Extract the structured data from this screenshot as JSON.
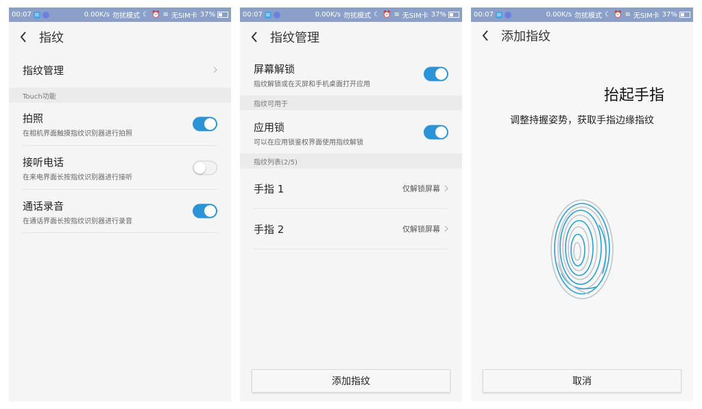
{
  "status": {
    "time": "00:07",
    "speed": "0.00K/s",
    "dnd": "勿扰模式",
    "sim": "无SIM卡",
    "battery": "37%",
    "battery_level": 0.37,
    "color": "#8aa0c8"
  },
  "accent": "#2b93d6",
  "screen1": {
    "title": "指纹",
    "manage_label": "指纹管理",
    "section_label": "Touch功能",
    "items": [
      {
        "title": "拍照",
        "sub": "在相机界面触摸指纹识别器进行拍照",
        "on": true
      },
      {
        "title": "接听电话",
        "sub": "在来电界面长按指纹识别器进行接听",
        "on": false
      },
      {
        "title": "通话录音",
        "sub": "在通话界面长按指纹识别器进行录音",
        "on": true
      }
    ]
  },
  "screen2": {
    "title": "指纹管理",
    "unlock": {
      "title": "屏幕解锁",
      "sub": "指纹解锁或在灭屏和手机桌面打开应用",
      "on": true
    },
    "usable_section": "指纹可用于",
    "applock": {
      "title": "应用锁",
      "sub": "可以在应用锁鉴权界面使用指纹解锁",
      "on": true
    },
    "list_section": "指纹列表(2/5)",
    "fingers": [
      {
        "name": "手指 1",
        "usage": "仅解锁屏幕"
      },
      {
        "name": "手指 2",
        "usage": "仅解锁屏幕"
      }
    ],
    "add_button": "添加指纹"
  },
  "screen3": {
    "title": "添加指纹",
    "lift_text": "抬起手指",
    "instruction": "调整持握姿势，获取手指边缘指纹",
    "cancel_button": "取消"
  },
  "icons": [
    "back-icon",
    "chevron-right-icon",
    "wifi-icon",
    "alarm-icon",
    "moon-icon",
    "battery-icon",
    "fingerprint-icon"
  ]
}
